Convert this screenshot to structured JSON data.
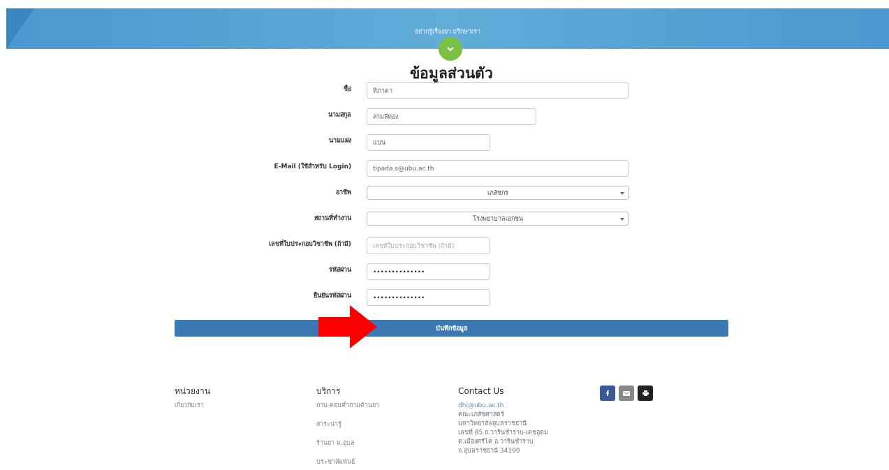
{
  "banner": {
    "tagline": "อยากรู้เรื่องยา ปรึกษาเรา"
  },
  "form": {
    "title": "ข้อมูลส่วนตัว",
    "fields": [
      {
        "kind": "text",
        "label": "ชื่อ",
        "value": "ทิภาดา"
      },
      {
        "kind": "text",
        "label": "นามสกุล",
        "value": "สามสีทอง"
      },
      {
        "kind": "text",
        "label": "นามแฝง",
        "value": "แบน"
      },
      {
        "kind": "text",
        "label": "E-Mail (ใช้สำหรับ Login)",
        "value": "tipada.s@ubu.ac.th"
      },
      {
        "kind": "select",
        "label": "อาชีพ",
        "value": "เภสัชกร"
      },
      {
        "kind": "select",
        "label": "สถานที่ทำงาน",
        "value": "โรงพยาบาลเอกชน"
      },
      {
        "kind": "text",
        "label": "เลขที่ใบประกอบวิชาชีพ (ถ้ามี)",
        "placeholder": "เลขที่ใบประกอบวิชาชีพ (ถ้ามี)"
      },
      {
        "kind": "password",
        "label": "รหัสผ่าน",
        "value": "••••••••••••••"
      },
      {
        "kind": "password",
        "label": "ยืนยันรหัสผ่าน",
        "value": "••••••••••••••"
      }
    ],
    "submit": "บันทึกข้อมูล"
  },
  "footer": {
    "columns": [
      {
        "heading": "หน่วยงาน",
        "links": [
          "เกี่ยวกับเรา"
        ]
      },
      {
        "heading": "บริการ",
        "links": [
          "ถาม-ตอบคำถามด้านยา",
          "สาระน่ารู้",
          "ร้านยา ม.อุบล",
          "ประชาสัมพันธ์"
        ]
      },
      {
        "heading": "Contact Us",
        "email": "dhi@ubu.ac.th",
        "address": [
          "คณะเภสัชศาสตร์",
          "มหาวิทยาลัยอุบลราชธานี",
          "เลขที่ 85 ถ.วารินชำราบ-เดชอุดม",
          "ต.เมืองศรีไค อ.วารินชำราบ",
          "จ.อุบลราชธานี 34190"
        ]
      }
    ],
    "social": [
      {
        "kind": "facebook"
      },
      {
        "kind": "email"
      },
      {
        "kind": "print"
      }
    ]
  }
}
